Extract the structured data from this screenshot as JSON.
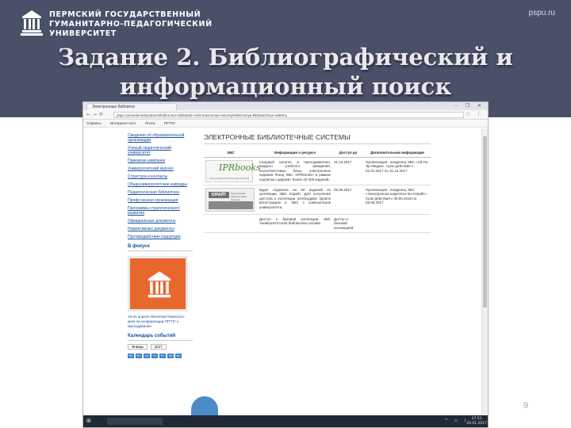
{
  "header": {
    "university": [
      "ПЕРМСКИЙ ГОСУДАРСТВЕННЫЙ",
      "ГУМАНИТАРНО-ПЕДАГОГИЧЕСКИЙ",
      "УНИВЕРСИТЕТ"
    ],
    "site": "pspu.ru",
    "title_line1": "Задание 2. Библиографический и",
    "title_line2": "информационный поиск"
  },
  "browser": {
    "tab_label": "Электронные библиоте",
    "window_buttons": "– ❐ ✕",
    "url": "pspu.ru/sveden/education/elektronnye-biblioteki-i-informacionnye-resursy/elektronnye-bibliotechnye-sistemy",
    "bookmarks": [
      "Сервисы",
      "Интеренет-пост",
      "Почта",
      "ПГГПУ"
    ]
  },
  "sidebar": {
    "links": [
      "Сведения об образовательной организации",
      "Ученый педагогический университет",
      "Приемная кампания",
      "Университетский журнал",
      "Структура и контакты",
      "Общеуниверситетские кафедры",
      "Педагогическая библиотека",
      "Профсоюзная организация",
      "Программы стратегического развития",
      "Официальные документы",
      "Нормативные документы",
      "Противодействие коррупции"
    ],
    "focus_title": "В фокусе",
    "focus_text": "19-23 апреля Жителям Пермского края на конференции ПГГПУ о преподавании",
    "calendar_title": "Календарь событий",
    "calendar_month": "Январь",
    "calendar_year": "2017",
    "calendar_days": [
      "Пн",
      "Вт",
      "Ср",
      "Чт",
      "Пт",
      "Сб",
      "Вс"
    ]
  },
  "main": {
    "heading": "ЭЛЕКТРОННЫЕ БИБЛИОТЕЧНЫЕ СИСТЕМЫ",
    "columns": [
      "ЭБС",
      "Информация о ресурсе",
      "Доступ до",
      "Дополнительная информация"
    ],
    "rows": [
      {
        "logo_text": "IPRbooks",
        "logo_sub": "электронная библиотечная система",
        "description": "Сводный каталог и преподавателю, каждого учебного заведения, полнотекстовые базы, электронные издания. Фонд ЭБС «IPRbooks» в рамках подписки содержит более 20 000 изданий.",
        "access": "31.12.2017",
        "extra": "Организация - владелец ЭБС «Ай Пи Эр Медиа». Срок действия с 01.01.2017 по 31.12.2017"
      },
      {
        "logo_text": "ЮРАЙТ",
        "logo_sub": "Электронная библиотечная система",
        "description": "Будет подписка на 50 изданий из коллекции ЭБС Юрайт. Для получения доступа к коллекции необходимо пройти регистрацию в ЭБС с компьютеров университета.",
        "access": "05.06.2017",
        "extra": "Организация - владелец ЭБС «Электронное издательство Юрайт». Срок действия с 06.06.2016 по 05.06.2017"
      },
      {
        "logo_text": "",
        "logo_sub": "",
        "description": "Доступ к базовой коллекции ЭБС Университетская библиотека онлайн",
        "access": "Доступ с базовой коллекцией",
        "extra": ""
      }
    ]
  },
  "taskbar": {
    "time": "17:51",
    "date": "20.01.2017"
  },
  "slide_number": "9"
}
